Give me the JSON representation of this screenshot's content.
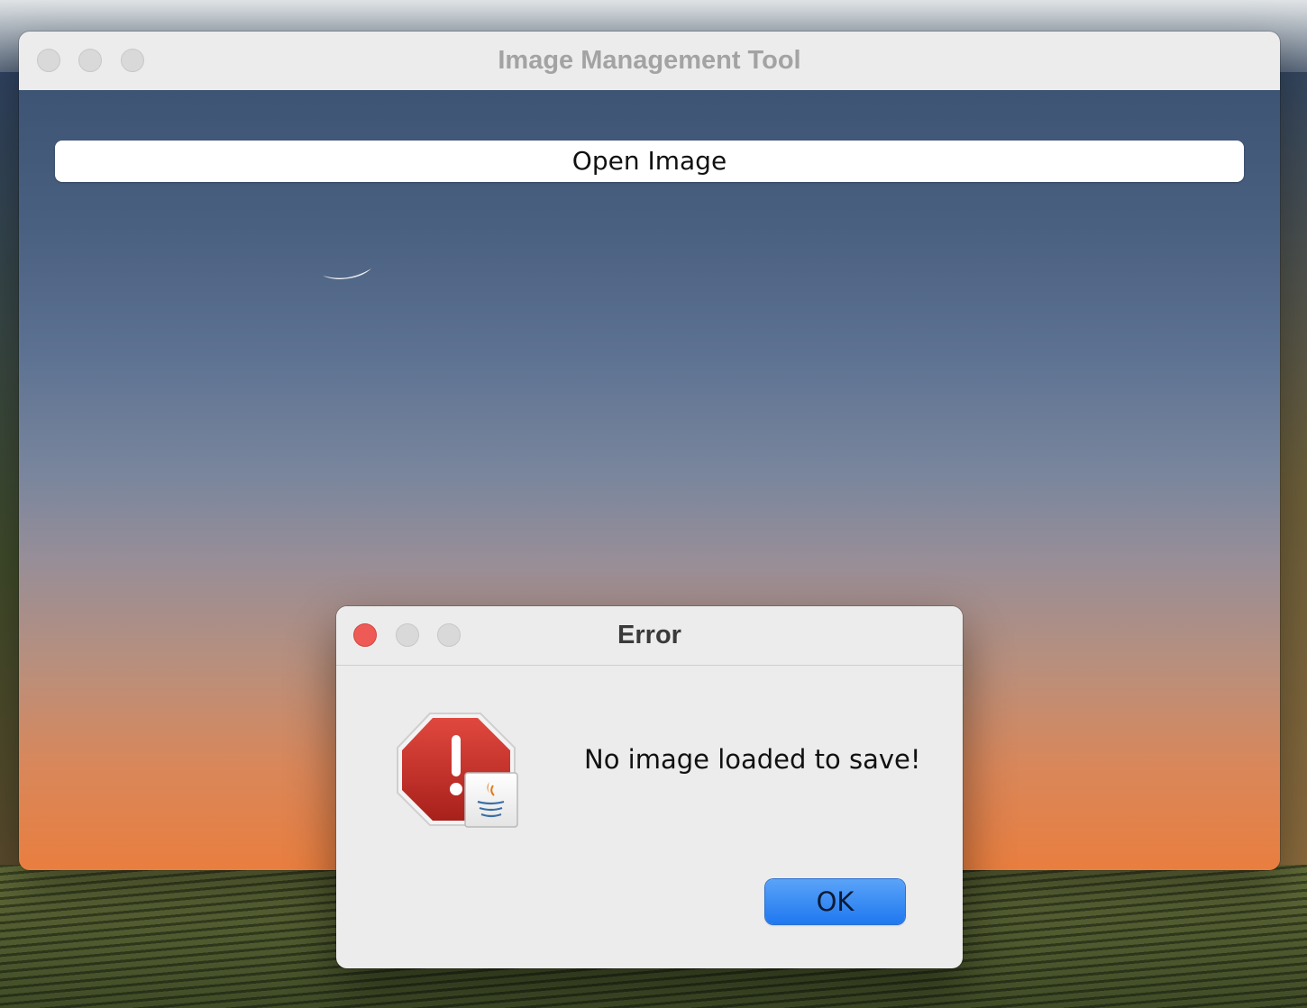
{
  "main_window": {
    "title": "Image Management Tool",
    "open_image_label": "Open Image"
  },
  "dialog": {
    "title": "Error",
    "message": "No image loaded to save!",
    "ok_label": "OK",
    "icon": "error-stop-sign-icon",
    "badge_icon": "java-badge-icon"
  },
  "colors": {
    "close_red": "#ee5b57",
    "ok_blue": "#1f78f0",
    "error_red": "#c62f28"
  }
}
